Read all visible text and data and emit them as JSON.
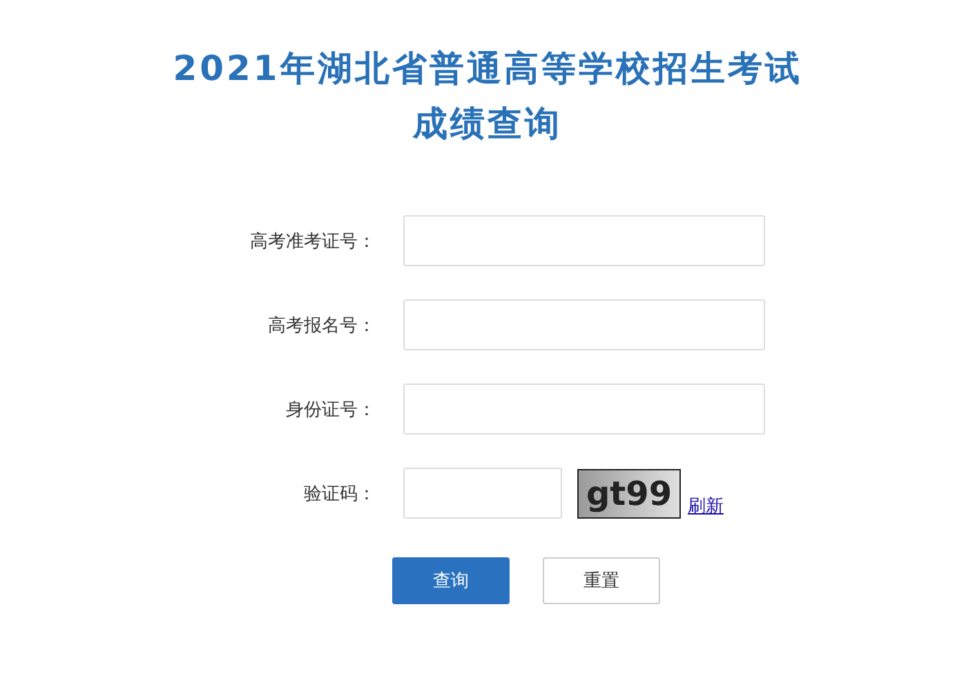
{
  "title": {
    "line_1": "2021年湖北省普通高等学校招生考试",
    "line_2": "成绩查询"
  },
  "fields": [
    {
      "label": "高考准考证号：",
      "kind": "text"
    },
    {
      "label": "高考报名号：",
      "kind": "text"
    },
    {
      "label": "身份证号：",
      "kind": "text"
    },
    {
      "label": "验证码：",
      "kind": "captcha",
      "captcha": "gt99",
      "refresh_link": "刷新"
    }
  ],
  "buttons": [
    {
      "label": "查询",
      "kind": "primary"
    },
    {
      "label": "重置",
      "kind": "secondary"
    }
  ]
}
